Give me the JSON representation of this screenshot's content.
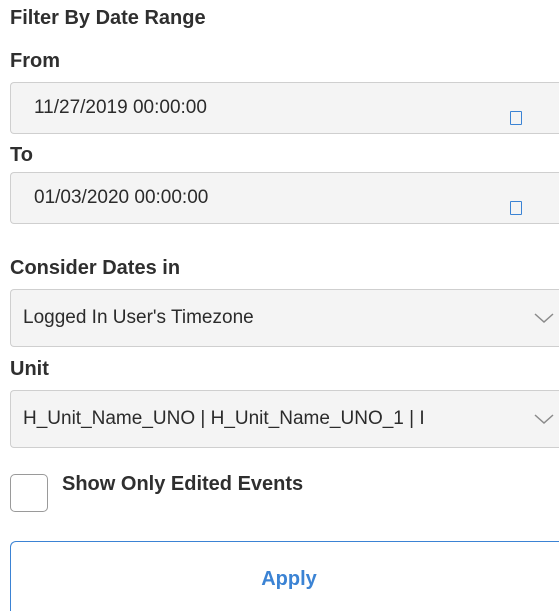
{
  "filter": {
    "title": "Filter By Date Range",
    "from_label": "From",
    "from_value": "11/27/2019 00:00:00",
    "to_label": "To",
    "to_value": "01/03/2020 00:00:00",
    "consider_label": "Consider Dates in",
    "consider_value": "Logged In User's Timezone",
    "unit_label": "Unit",
    "unit_value": "H_Unit_Name_UNO | H_Unit_Name_UNO_1 | I",
    "checkbox_label": "Show Only Edited Events",
    "checkbox_checked": false,
    "apply_label": "Apply"
  },
  "icons": {
    "calendar": "calendar-icon",
    "chevron": "chevron-down-icon"
  },
  "colors": {
    "accent": "#3b83d4",
    "field_background": "#f4f4f4",
    "label_text": "#2f2f2f"
  }
}
